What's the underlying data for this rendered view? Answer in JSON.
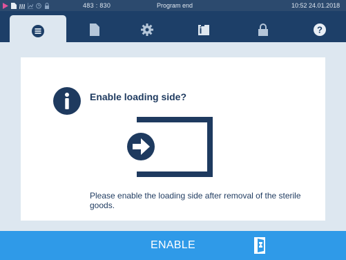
{
  "status": {
    "icons": [
      "play-icon",
      "document-icon",
      "steam-icon",
      "chart-icon",
      "clock-icon",
      "lock-icon"
    ],
    "coords": "483 : 830",
    "program_status": "Program end",
    "time": "10:52",
    "date": "24.01.2018"
  },
  "tabs": [
    {
      "name": "menu",
      "icon": "list-icon",
      "active": true
    },
    {
      "name": "logs",
      "icon": "document-icon",
      "active": false
    },
    {
      "name": "settings",
      "icon": "gear-icon",
      "active": false
    },
    {
      "name": "info",
      "icon": "info-door-icon",
      "active": false
    },
    {
      "name": "lock",
      "icon": "lock-icon",
      "active": false
    },
    {
      "name": "help",
      "icon": "help-icon",
      "active": false
    }
  ],
  "dialog": {
    "question": "Enable loading side?",
    "message": "Please enable the loading side after removal of the sterile goods."
  },
  "action": {
    "label": "ENABLE"
  },
  "colors": {
    "status_bar": "#2c4a6e",
    "tab_bar": "#1d3f68",
    "panel_bg": "#dde7f0",
    "accent": "#2f9ae8",
    "text": "#1e3a5f"
  }
}
